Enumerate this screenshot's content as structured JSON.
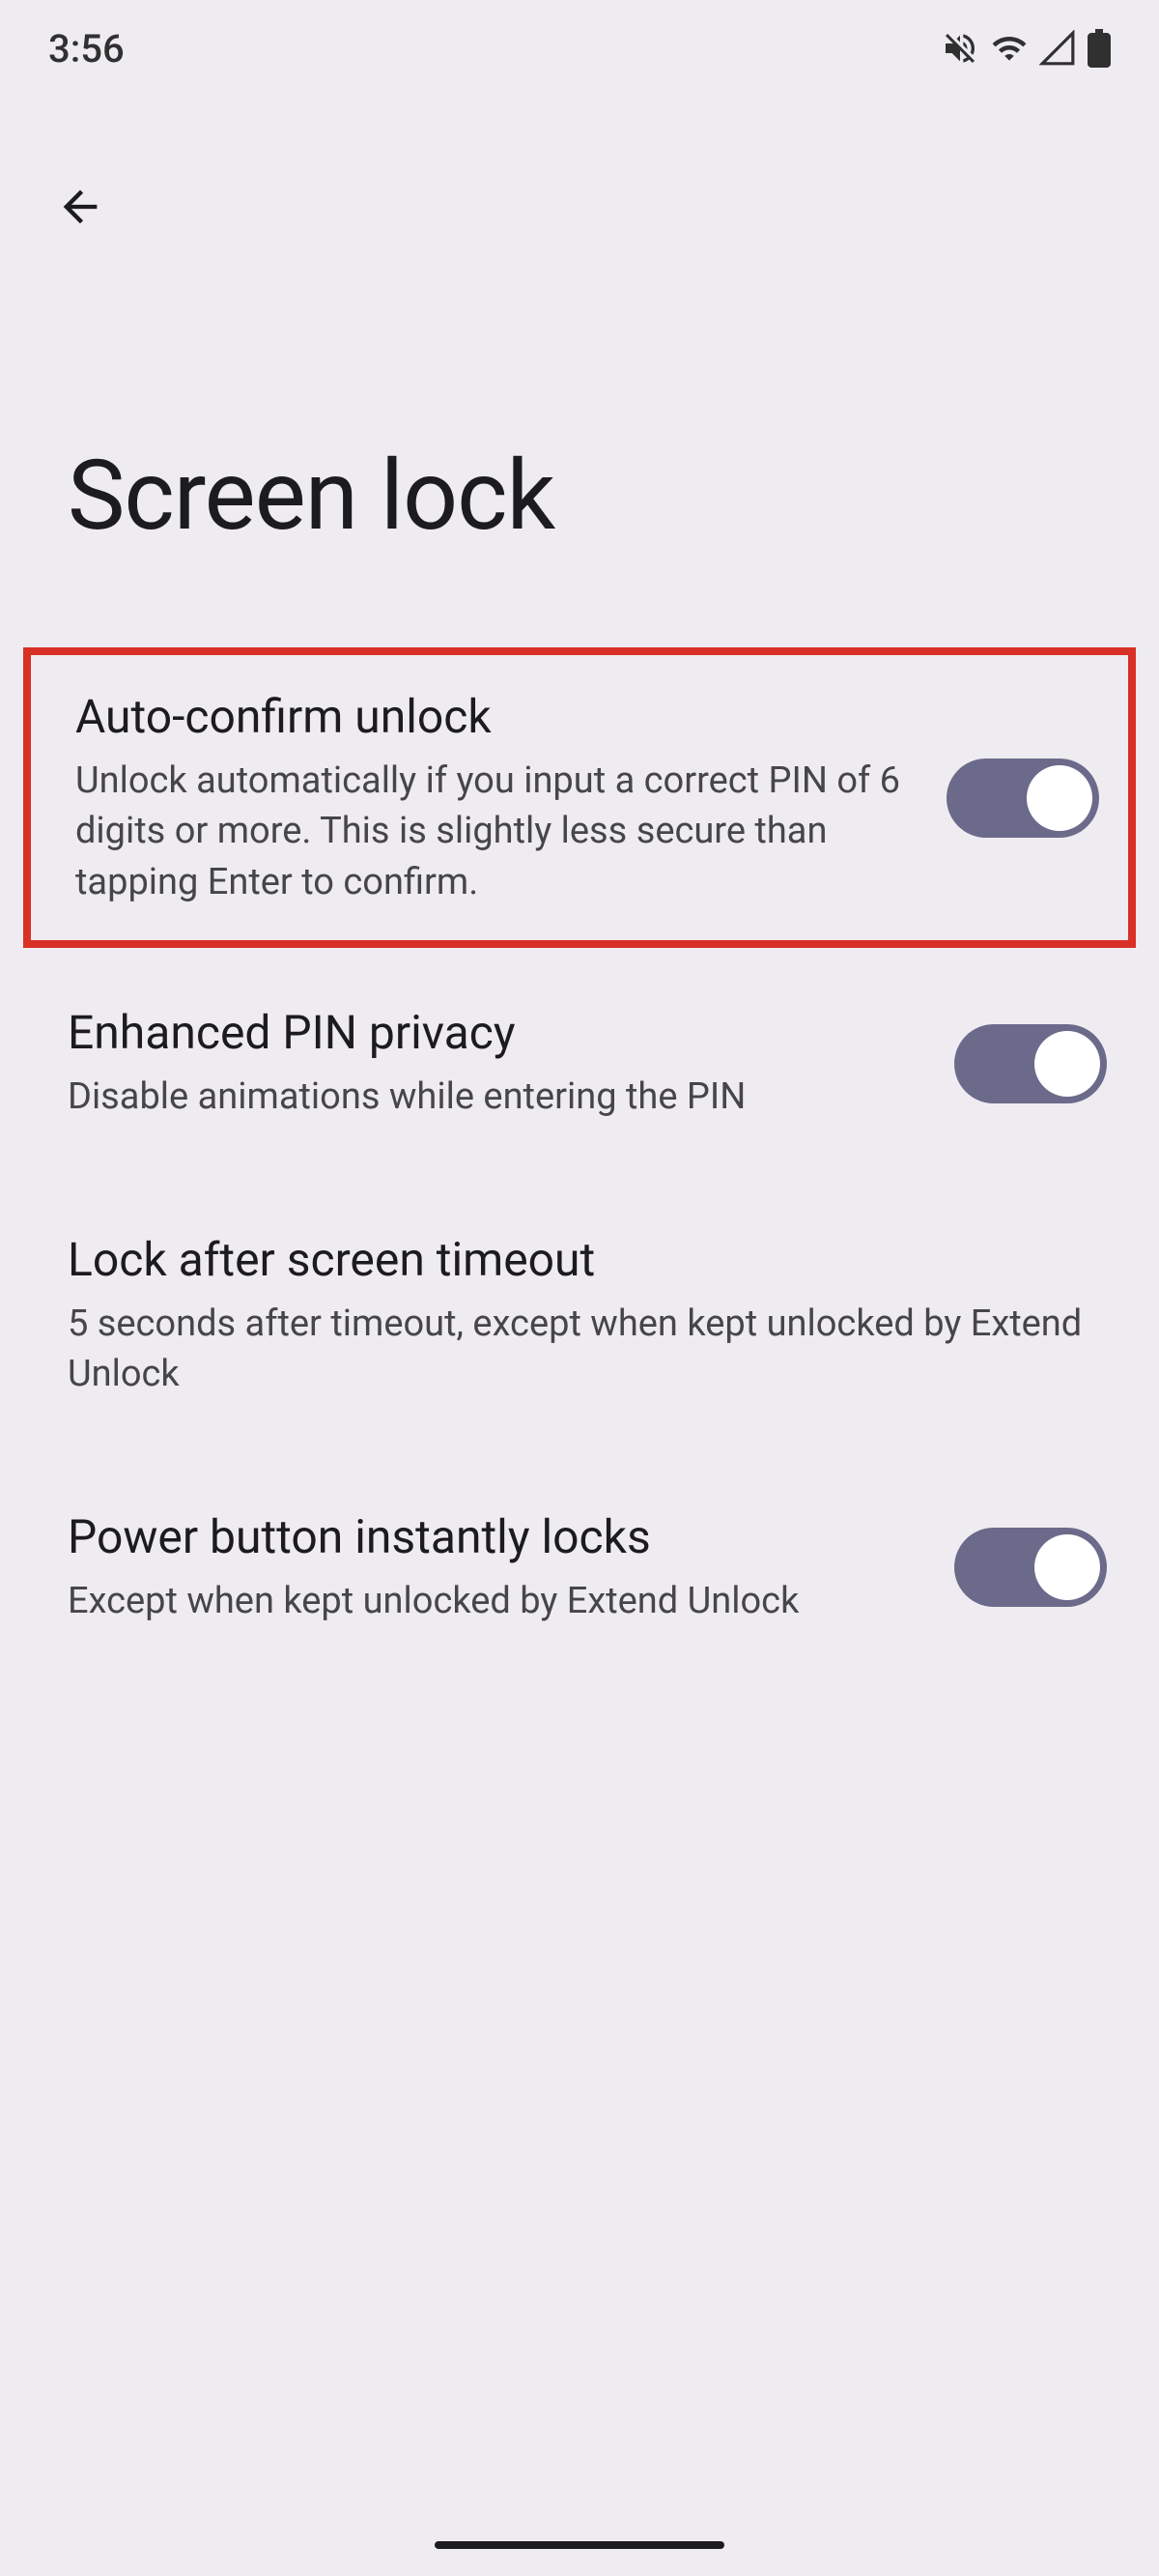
{
  "status": {
    "time": "3:56"
  },
  "nav": {
    "back_label": "Back"
  },
  "page": {
    "title": "Screen lock"
  },
  "settings": [
    {
      "title": "Auto-confirm unlock",
      "desc": "Unlock automatically if you input a correct PIN of 6 digits or more. This is slightly less secure than tapping Enter to confirm.",
      "switch_on": true,
      "highlighted": true
    },
    {
      "title": "Enhanced PIN privacy",
      "desc": "Disable animations while entering the PIN",
      "switch_on": true,
      "highlighted": false
    },
    {
      "title": "Lock after screen timeout",
      "desc": "5 seconds after timeout, except when kept unlocked by Extend Unlock",
      "switch_on": null,
      "highlighted": false
    },
    {
      "title": "Power button instantly locks",
      "desc": "Except when kept unlocked by Extend Unlock",
      "switch_on": true,
      "highlighted": false
    }
  ]
}
